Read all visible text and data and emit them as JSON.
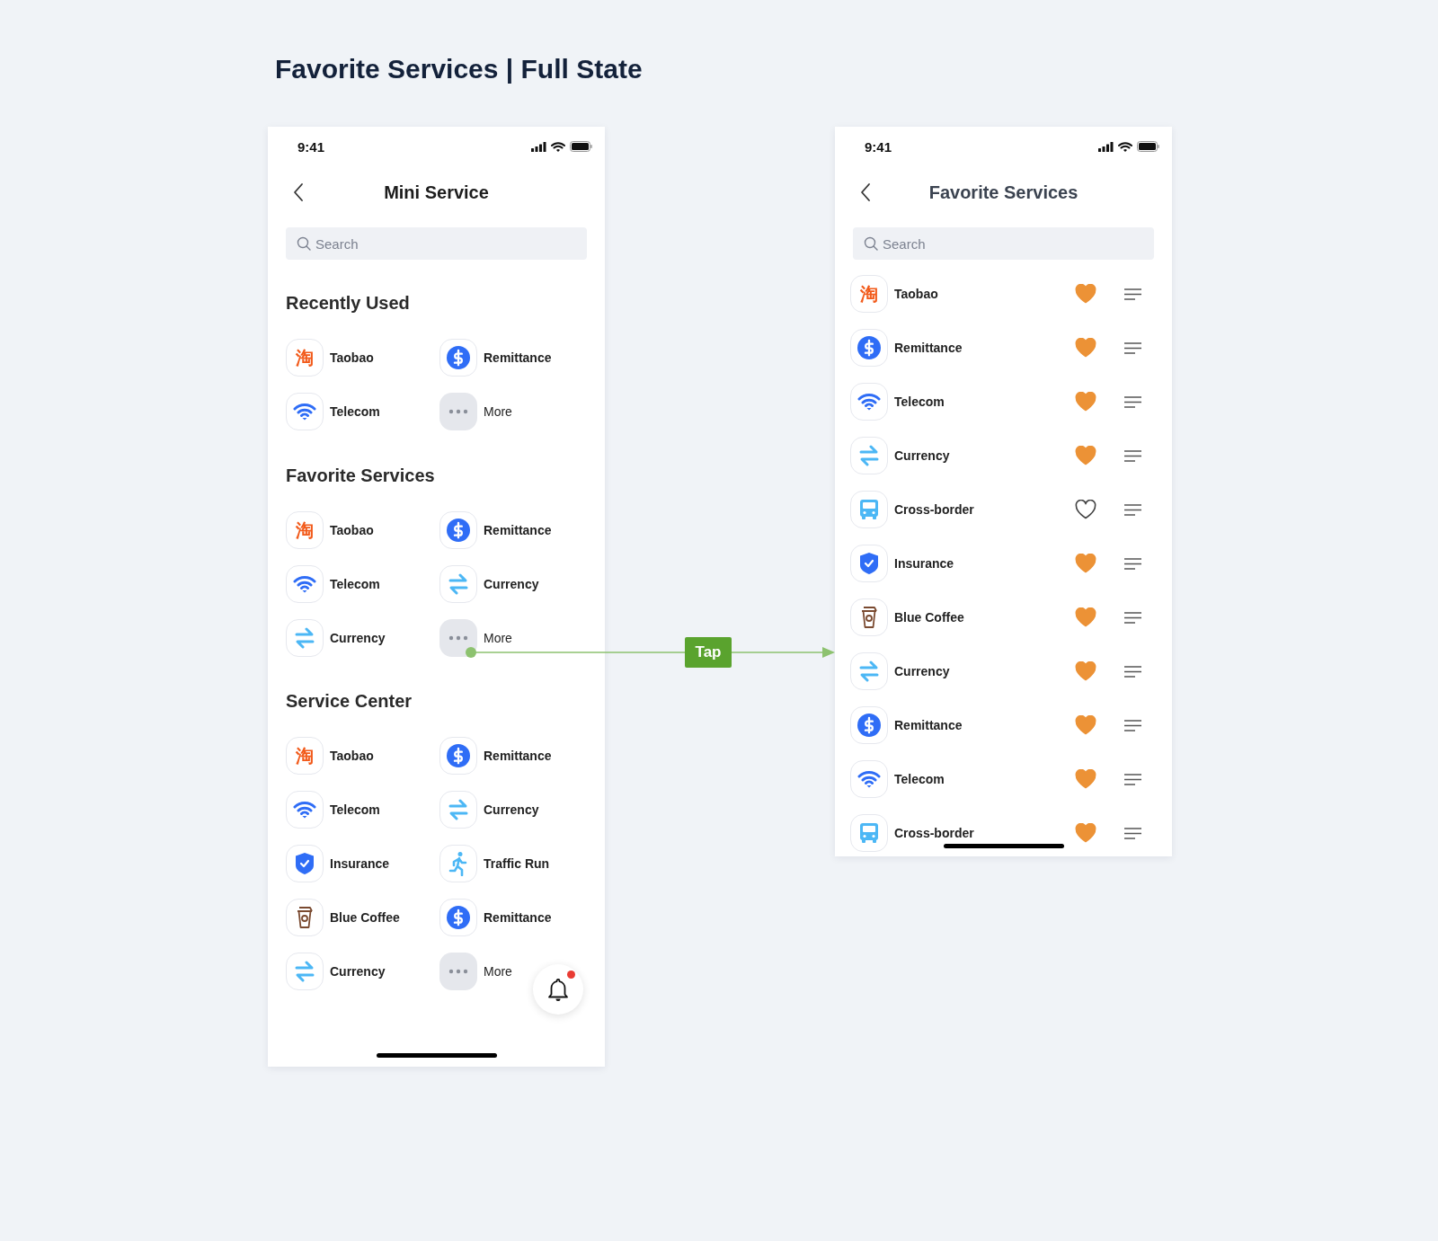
{
  "page_title": "Favorite Services | Full State",
  "mini_service": {
    "status_time": "9:41",
    "title": "Mini Service",
    "search": {
      "placeholder": "Search"
    },
    "sections": [
      {
        "heading": "Recently Used",
        "items": [
          {
            "kind": "taobao",
            "glyph": "淘",
            "label": "Taobao"
          },
          {
            "kind": "remittance",
            "label": "Remittance"
          },
          {
            "kind": "telecom",
            "label": "Telecom"
          },
          {
            "kind": "more",
            "label": "More"
          }
        ]
      },
      {
        "heading": "Favorite Services",
        "items": [
          {
            "kind": "taobao",
            "glyph": "淘",
            "label": "Taobao"
          },
          {
            "kind": "remittance",
            "label": "Remittance"
          },
          {
            "kind": "telecom",
            "label": "Telecom"
          },
          {
            "kind": "currency",
            "label": "Currency"
          },
          {
            "kind": "currency",
            "label": "Currency"
          },
          {
            "kind": "more",
            "label": "More"
          }
        ]
      },
      {
        "heading": "Service Center",
        "items": [
          {
            "kind": "taobao",
            "glyph": "淘",
            "label": "Taobao"
          },
          {
            "kind": "remittance",
            "label": "Remittance"
          },
          {
            "kind": "telecom",
            "label": "Telecom"
          },
          {
            "kind": "currency",
            "label": "Currency"
          },
          {
            "kind": "insurance",
            "label": "Insurance"
          },
          {
            "kind": "traffic",
            "label": "Traffic Run"
          },
          {
            "kind": "coffee",
            "label": "Blue Coffee"
          },
          {
            "kind": "remittance",
            "label": "Remittance"
          },
          {
            "kind": "currency",
            "label": "Currency"
          },
          {
            "kind": "more",
            "label": "More"
          }
        ]
      }
    ],
    "notification": {
      "unread": true
    }
  },
  "transition": {
    "label": "Tap"
  },
  "favorites": {
    "status_time": "9:41",
    "title": "Favorite Services",
    "search": {
      "placeholder": "Search"
    },
    "items": [
      {
        "kind": "taobao",
        "glyph": "淘",
        "label": "Taobao",
        "favorite": true
      },
      {
        "kind": "remittance",
        "label": "Remittance",
        "favorite": true
      },
      {
        "kind": "telecom",
        "label": "Telecom",
        "favorite": true
      },
      {
        "kind": "currency",
        "label": "Currency",
        "favorite": true
      },
      {
        "kind": "bus",
        "label": "Cross-border",
        "favorite": false
      },
      {
        "kind": "insurance",
        "label": "Insurance",
        "favorite": true
      },
      {
        "kind": "coffee",
        "label": "Blue Coffee",
        "favorite": true
      },
      {
        "kind": "currency",
        "label": "Currency",
        "favorite": true
      },
      {
        "kind": "remittance",
        "label": "Remittance",
        "favorite": true
      },
      {
        "kind": "telecom",
        "label": "Telecom",
        "favorite": true
      },
      {
        "kind": "bus",
        "label": "Cross-border",
        "favorite": true
      }
    ]
  }
}
